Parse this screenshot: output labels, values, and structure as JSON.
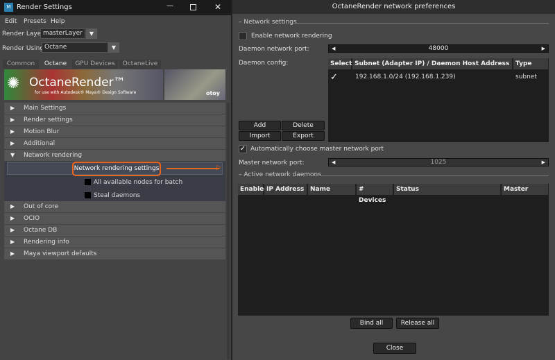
{
  "left_window": {
    "title": "Render Settings",
    "menu": [
      "Edit",
      "Presets",
      "Help"
    ],
    "render_layer_label": "Render Layer",
    "render_layer_value": "masterLayer",
    "render_using_label": "Render Using",
    "render_using_value": "Octane",
    "tabs": [
      "Common",
      "Octane",
      "GPU Devices",
      "OctaneLive"
    ],
    "active_tab": "Octane",
    "banner": {
      "title": "OctaneRender™",
      "subtitle": "for use with Autodesk® Maya® Design Software",
      "logo": "otoy"
    },
    "sections": [
      "Main Settings",
      "Render settings",
      "Motion Blur",
      "Additional",
      "Network rendering",
      "Out of core",
      "OCIO",
      "Octane DB",
      "Rendering info",
      "Maya viewport defaults"
    ],
    "network": {
      "settings_button": "Network rendering settings",
      "all_nodes_label": "All available nodes for batch",
      "steal_label": "Steal daemons"
    },
    "highlight_color": "#e8661e"
  },
  "right_window": {
    "title": "OctaneRender network preferences",
    "network_settings_group": "Network settings",
    "enable_label": "Enable network rendering",
    "enable_checked": false,
    "daemon_port_label": "Daemon network port:",
    "daemon_port_value": "48000",
    "daemon_config_label": "Daemon config:",
    "config_table": {
      "headers": [
        "Select",
        "Subnet (Adapter IP) / Daemon Host Address",
        "Type"
      ],
      "rows": [
        {
          "selected": true,
          "address": "192.168.1.0/24 (192.168.1.239)",
          "type": "subnet"
        }
      ]
    },
    "buttons": {
      "add": "Add",
      "delete": "Delete",
      "import": "Import",
      "export": "Export"
    },
    "auto_master_label": "Automatically choose master network port",
    "auto_master_checked": true,
    "master_port_label": "Master network port:",
    "master_port_value": "1025",
    "active_group": "Active network daemons",
    "daemons_table": {
      "headers": [
        "Enabled",
        "IP Address",
        "Name",
        "# Devices",
        "Status",
        "Master"
      ],
      "rows": []
    },
    "bind_all": "Bind all",
    "release_all": "Release all",
    "close": "Close"
  }
}
